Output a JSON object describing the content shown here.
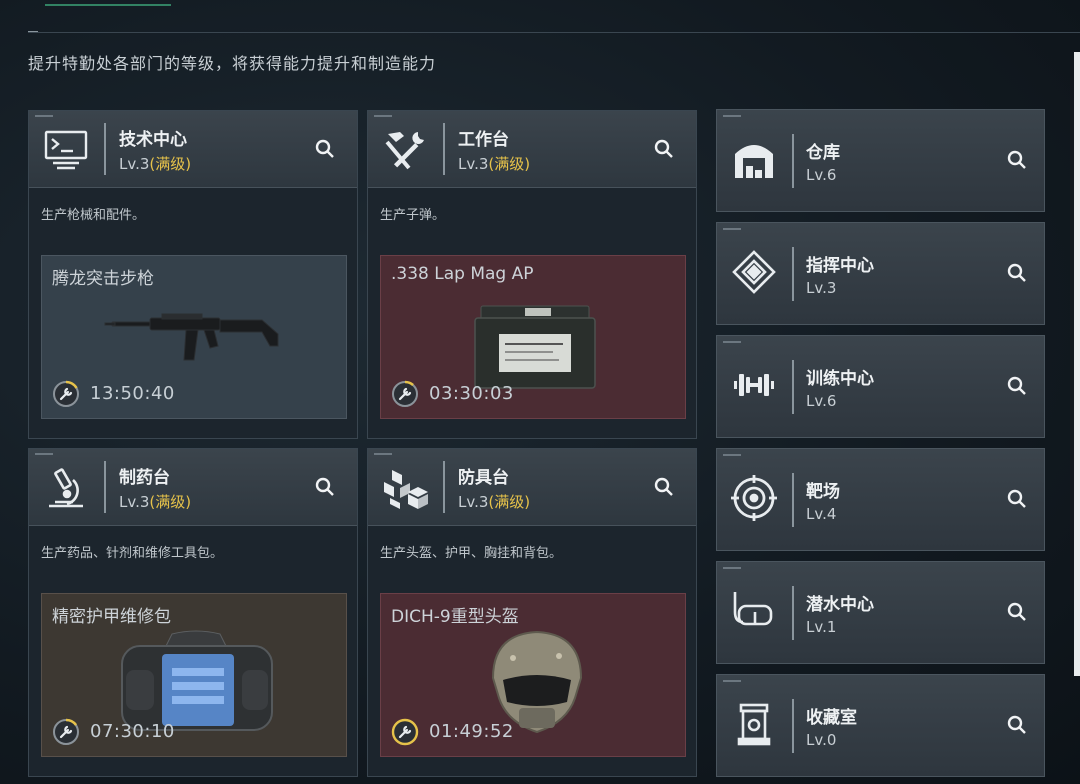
{
  "header": {
    "description": "提升特勤处各部门的等级，将获得能力提升和制造能力"
  },
  "departments": [
    {
      "name": "技术中心",
      "level": "Lv.3",
      "max_label": "(满级)",
      "icon": "computer-terminal-icon",
      "description": "生产枪械和配件。",
      "item": {
        "name": "腾龙突击步枪",
        "timer": "13:50:40",
        "image": "assault-rifle-image"
      }
    },
    {
      "name": "工作台",
      "level": "Lv.3",
      "max_label": "(满级)",
      "icon": "hammer-wrench-icon",
      "description": "生产子弹。",
      "item": {
        "name": ".338 Lap Mag AP",
        "timer": "03:30:03",
        "image": "ammo-box-image"
      }
    },
    {
      "name": "制药台",
      "level": "Lv.3",
      "max_label": "(满级)",
      "icon": "microscope-icon",
      "description": "生产药品、针剂和维修工具包。",
      "item": {
        "name": "精密护甲维修包",
        "timer": "07:30:10",
        "image": "repair-bag-image"
      }
    },
    {
      "name": "防具台",
      "level": "Lv.3",
      "max_label": "(满级)",
      "icon": "stacked-cubes-icon",
      "description": "生产头盔、护甲、胸挂和背包。",
      "item": {
        "name": "DICH-9重型头盔",
        "timer": "01:49:52",
        "image": "heavy-helmet-image"
      }
    }
  ],
  "rooms": [
    {
      "name": "仓库",
      "level": "Lv.6",
      "icon": "warehouse-icon"
    },
    {
      "name": "指挥中心",
      "level": "Lv.3",
      "icon": "command-emblem-icon"
    },
    {
      "name": "训练中心",
      "level": "Lv.6",
      "icon": "dumbbell-icon"
    },
    {
      "name": "靶场",
      "level": "Lv.4",
      "icon": "target-icon"
    },
    {
      "name": "潜水中心",
      "level": "Lv.1",
      "icon": "diving-mask-icon"
    },
    {
      "name": "收藏室",
      "level": "Lv.0",
      "icon": "display-case-icon"
    }
  ],
  "colors": {
    "max_level": "#e6c24a",
    "timer_ring": "#e6c24a",
    "item_grey": "#35414b",
    "item_red": "#4b2c33",
    "item_brown": "#3d3832"
  }
}
